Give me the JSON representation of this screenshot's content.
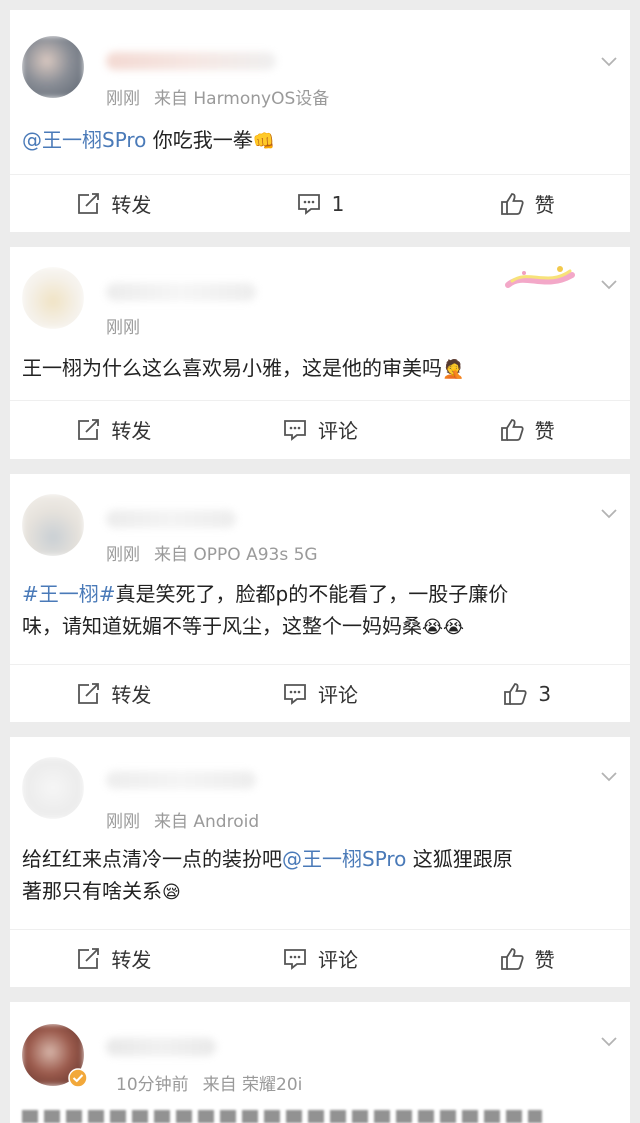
{
  "posts": [
    {
      "meta_time": "刚刚",
      "meta_source": "来自 HarmonyOS设备",
      "text_mention": "@王一栩SPro",
      "text_body": " 你吃我一拳",
      "emoji": "👊",
      "actions": {
        "repost": "转发",
        "comment": "1",
        "like": "赞"
      }
    },
    {
      "meta_time": "刚刚",
      "meta_source": "",
      "text_body": "王一栩为什么这么喜欢易小雅，这是他的审美吗",
      "emoji": "🤦",
      "actions": {
        "repost": "转发",
        "comment": "评论",
        "like": "赞"
      }
    },
    {
      "meta_time": "刚刚",
      "meta_source": "来自 OPPO A93s 5G",
      "text_hashtag": "#王一栩#",
      "text_body_line1": "真是笑死了，脸都p的不能看了，一股子廉价",
      "text_body_line2": "味，请知道妩媚不等于风尘，这整个一妈妈桑",
      "emoji": "😭😭",
      "actions": {
        "repost": "转发",
        "comment": "评论",
        "like": "3"
      }
    },
    {
      "meta_time": "刚刚",
      "meta_source": "来自 Android",
      "text_prefix": "给红红来点清冷一点的装扮吧",
      "text_mention": "@王一栩SPro",
      "text_suffix": " 这狐狸跟原",
      "text_line2": "著那只有啥关系",
      "emoji": "😪",
      "actions": {
        "repost": "转发",
        "comment": "评论",
        "like": "赞"
      }
    },
    {
      "meta_time": "10分钟前",
      "meta_source": "来自 荣耀20i"
    }
  ],
  "icons": [
    "repost-icon",
    "comment-icon",
    "like-icon",
    "chevron-down-icon",
    "verified-badge-icon"
  ],
  "colors": {
    "link": "#4a7ab8",
    "meta": "#9a9a9a",
    "background": "#ececec",
    "verified": "#f2a83a"
  }
}
